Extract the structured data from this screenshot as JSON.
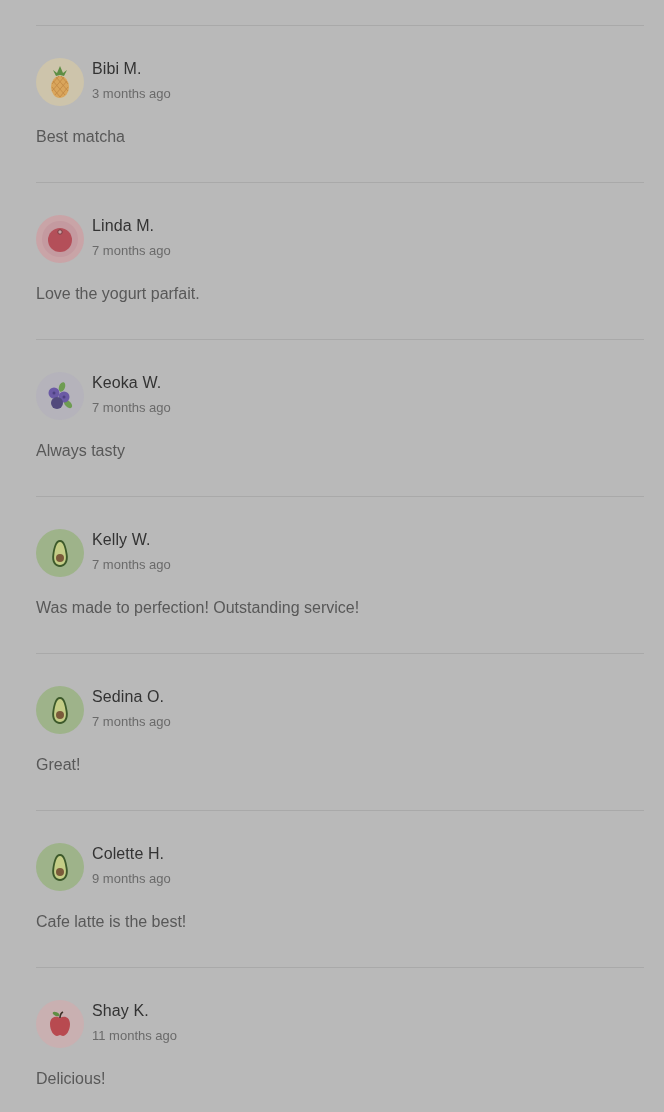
{
  "reviews": [
    {
      "kind": "pineapple",
      "name": "Bibi M.",
      "date": "3 months ago",
      "text": "Best matcha"
    },
    {
      "kind": "tomato",
      "name": "Linda M.",
      "date": "7 months ago",
      "text": "Love the yogurt parfait."
    },
    {
      "kind": "blueberries",
      "name": "Keoka W.",
      "date": "7 months ago",
      "text": "Always tasty"
    },
    {
      "kind": "avocado",
      "name": "Kelly W.",
      "date": "7 months ago",
      "text": "Was made to perfection! Outstanding service!"
    },
    {
      "kind": "avocado",
      "name": "Sedina O.",
      "date": "7 months ago",
      "text": "Great!"
    },
    {
      "kind": "avocado",
      "name": "Colette H.",
      "date": "9 months ago",
      "text": "Cafe latte is the best!"
    },
    {
      "kind": "apple",
      "name": "Shay K.",
      "date": "11 months ago",
      "text": "Delicious!"
    }
  ]
}
